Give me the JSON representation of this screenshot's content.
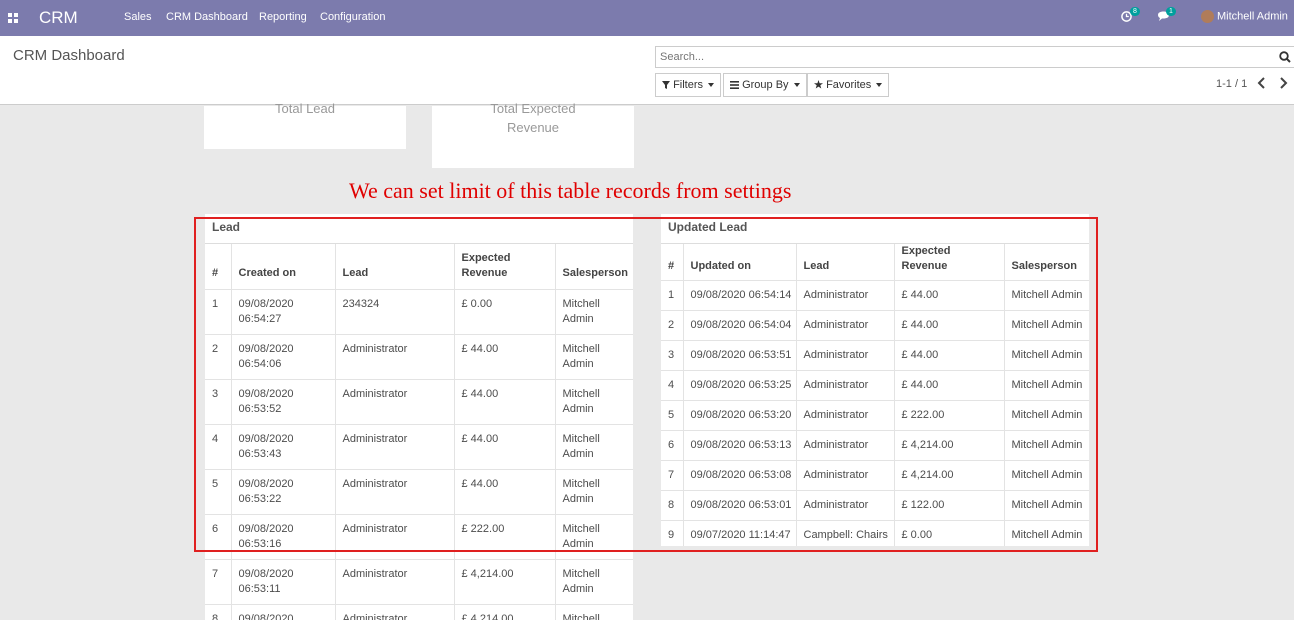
{
  "navbar": {
    "brand": "CRM",
    "menu": [
      "Sales",
      "CRM Dashboard",
      "Reporting",
      "Configuration"
    ],
    "activity_count": "8",
    "message_count": "1",
    "user_name": "Mitchell Admin",
    "bg_color": "#7c7bad"
  },
  "control_panel": {
    "title": "CRM Dashboard",
    "search_placeholder": "Search...",
    "filters_label": "Filters",
    "group_by_label": "Group By",
    "favorites_label": "Favorites",
    "pager": "1-1 / 1"
  },
  "cards": [
    {
      "label_line1": "Total Lead",
      "label_line2": ""
    },
    {
      "label_line1": "Total Expected",
      "label_line2": "Revenue"
    }
  ],
  "annotation": {
    "text": "We can set limit of this table records from settings",
    "color": "#e00000"
  },
  "lead_table": {
    "title": "Lead",
    "headers": {
      "num": "#",
      "created_on": "Created on",
      "lead": "Lead",
      "expected_revenue": "Expected Revenue",
      "salesperson": "Salesperson"
    },
    "rows": [
      {
        "num": "1",
        "created_on": "09/08/2020 06:54:27",
        "lead": "234324",
        "revenue": "£ 0.00",
        "salesperson": "Mitchell Admin"
      },
      {
        "num": "2",
        "created_on": "09/08/2020 06:54:06",
        "lead": "Administrator",
        "revenue": "£ 44.00",
        "salesperson": "Mitchell Admin"
      },
      {
        "num": "3",
        "created_on": "09/08/2020 06:53:52",
        "lead": "Administrator",
        "revenue": "£ 44.00",
        "salesperson": "Mitchell Admin"
      },
      {
        "num": "4",
        "created_on": "09/08/2020 06:53:43",
        "lead": "Administrator",
        "revenue": "£ 44.00",
        "salesperson": "Mitchell Admin"
      },
      {
        "num": "5",
        "created_on": "09/08/2020 06:53:22",
        "lead": "Administrator",
        "revenue": "£ 44.00",
        "salesperson": "Mitchell Admin"
      },
      {
        "num": "6",
        "created_on": "09/08/2020 06:53:16",
        "lead": "Administrator",
        "revenue": "£ 222.00",
        "salesperson": "Mitchell Admin"
      },
      {
        "num": "7",
        "created_on": "09/08/2020 06:53:11",
        "lead": "Administrator",
        "revenue": "£ 4,214.00",
        "salesperson": "Mitchell Admin"
      },
      {
        "num": "8",
        "created_on": "09/08/2020",
        "lead": "Administrator",
        "revenue": "£ 4,214.00",
        "salesperson": "Mitchell"
      }
    ]
  },
  "updated_table": {
    "title": "Updated Lead",
    "headers": {
      "num": "#",
      "updated_on": "Updated on",
      "lead": "Lead",
      "expected_revenue": "Expected Revenue",
      "salesperson": "Salesperson"
    },
    "rows": [
      {
        "num": "1",
        "updated_on": "09/08/2020 06:54:14",
        "lead": "Administrator",
        "revenue": "£ 44.00",
        "salesperson": "Mitchell Admin"
      },
      {
        "num": "2",
        "updated_on": "09/08/2020 06:54:04",
        "lead": "Administrator",
        "revenue": "£ 44.00",
        "salesperson": "Mitchell Admin"
      },
      {
        "num": "3",
        "updated_on": "09/08/2020 06:53:51",
        "lead": "Administrator",
        "revenue": "£ 44.00",
        "salesperson": "Mitchell Admin"
      },
      {
        "num": "4",
        "updated_on": "09/08/2020 06:53:25",
        "lead": "Administrator",
        "revenue": "£ 44.00",
        "salesperson": "Mitchell Admin"
      },
      {
        "num": "5",
        "updated_on": "09/08/2020 06:53:20",
        "lead": "Administrator",
        "revenue": "£ 222.00",
        "salesperson": "Mitchell Admin"
      },
      {
        "num": "6",
        "updated_on": "09/08/2020 06:53:13",
        "lead": "Administrator",
        "revenue": "£ 4,214.00",
        "salesperson": "Mitchell Admin"
      },
      {
        "num": "7",
        "updated_on": "09/08/2020 06:53:08",
        "lead": "Administrator",
        "revenue": "£ 4,214.00",
        "salesperson": "Mitchell Admin"
      },
      {
        "num": "8",
        "updated_on": "09/08/2020 06:53:01",
        "lead": "Administrator",
        "revenue": "£ 122.00",
        "salesperson": "Mitchell Admin"
      },
      {
        "num": "9",
        "updated_on": "09/07/2020 11:14:47",
        "lead": "Campbell: Chairs",
        "revenue": "£ 0.00",
        "salesperson": "Mitchell Admin"
      }
    ]
  }
}
